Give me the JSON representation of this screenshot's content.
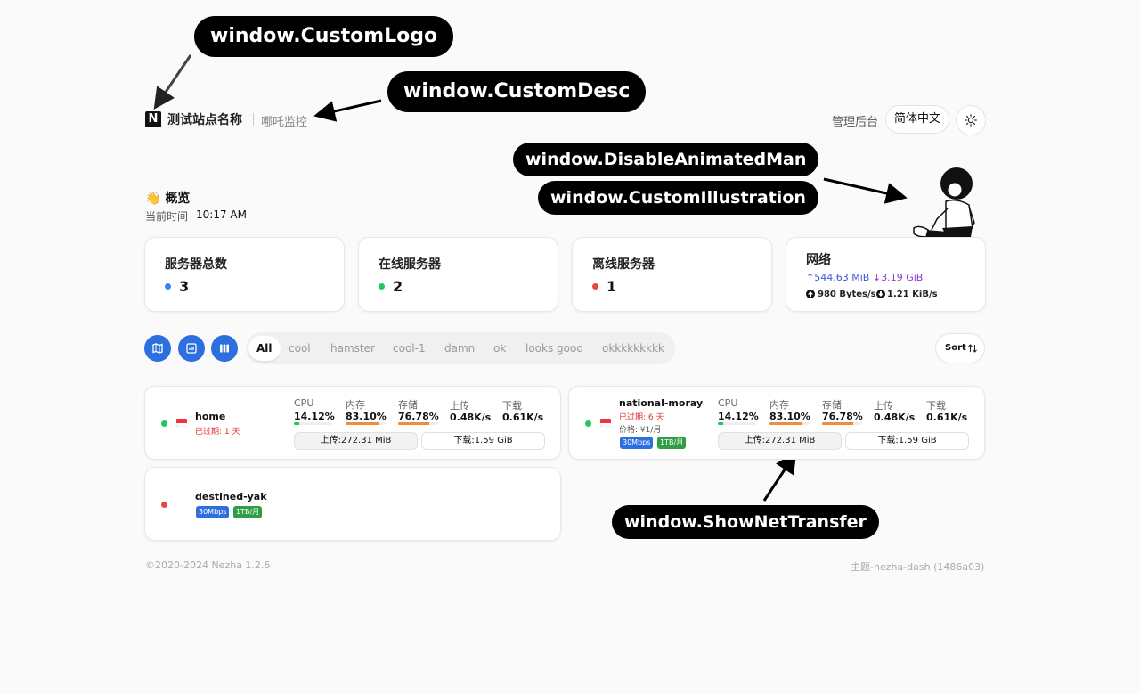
{
  "callouts": {
    "logo": "window.CustomLogo",
    "desc": "window.CustomDesc",
    "animated_man": "window.DisableAnimatedMan",
    "illustration": "window.CustomIllustration",
    "net_transfer": "window.ShowNetTransfer"
  },
  "header": {
    "logo_letter": "N",
    "site_name": "测试站点名称",
    "site_desc": "哪吒监控",
    "admin_link": "管理后台",
    "language": "简体中文",
    "theme_icon": "sun-icon"
  },
  "overview": {
    "emoji": "👋",
    "title": "概览",
    "time_label": "当前时间",
    "time_value": "10:17 AM"
  },
  "stats": {
    "total": {
      "label": "服务器总数",
      "value": "3",
      "color": "#3b82f6"
    },
    "online": {
      "label": "在线服务器",
      "value": "2",
      "color": "#22c55e"
    },
    "offline": {
      "label": "离线服务器",
      "value": "1",
      "color": "#ef4444"
    },
    "network": {
      "label": "网络",
      "upload": "↑544.63 MiB",
      "download": "↓3.19 GiB",
      "up_speed": "980 Bytes/s",
      "down_speed": "1.21 KiB/s"
    }
  },
  "toolbar": {
    "view_icons": [
      "map-icon",
      "chart-icon",
      "columns-icon"
    ],
    "tags": [
      "All",
      "cool",
      "hamster",
      "cool-1",
      "damn",
      "ok",
      "looks good",
      "okkkkkkkkk"
    ],
    "active_tag": "All",
    "sort_label": "Sort"
  },
  "servers": [
    {
      "name": "home",
      "status": "online",
      "expire": "已过期: 1 天",
      "cpu_label": "CPU",
      "cpu": "14.12%",
      "cpu_pct": 0.1412,
      "mem_label": "内存",
      "mem": "83.10%",
      "mem_pct": 0.831,
      "disk_label": "存储",
      "disk": "76.78%",
      "disk_pct": 0.7678,
      "up_label": "上传",
      "up": "0.48K/s",
      "down_label": "下载",
      "down": "0.61K/s",
      "transfer_up": "上传:272.31 MiB",
      "transfer_down": "下载:1.59 GiB"
    },
    {
      "name": "national-moray",
      "status": "online",
      "expire": "已过期: 6 天",
      "price": "价格: ¥1/月",
      "badges": [
        "30Mbps",
        "1TB/月"
      ],
      "cpu_label": "CPU",
      "cpu": "14.12%",
      "cpu_pct": 0.1412,
      "mem_label": "内存",
      "mem": "83.10%",
      "mem_pct": 0.831,
      "disk_label": "存储",
      "disk": "76.78%",
      "disk_pct": 0.7678,
      "up_label": "上传",
      "up": "0.48K/s",
      "down_label": "下载",
      "down": "0.61K/s",
      "transfer_up": "上传:272.31 MiB",
      "transfer_down": "下载:1.59 GiB"
    },
    {
      "name": "destined-yak",
      "status": "offline",
      "badges": [
        "30Mbps",
        "1TB/月"
      ]
    }
  ],
  "footer": {
    "copyright": "©2020-2024 Nezha 1.2.6",
    "theme": "主题-nezha-dash (1486a03)"
  },
  "colors": {
    "accent": "#2e6fe0",
    "online": "#22c55e",
    "offline": "#ef4444",
    "cpu_bar": "#22c55e",
    "mem_bar": "#f08c3c",
    "disk_bar": "#f08c3c"
  }
}
